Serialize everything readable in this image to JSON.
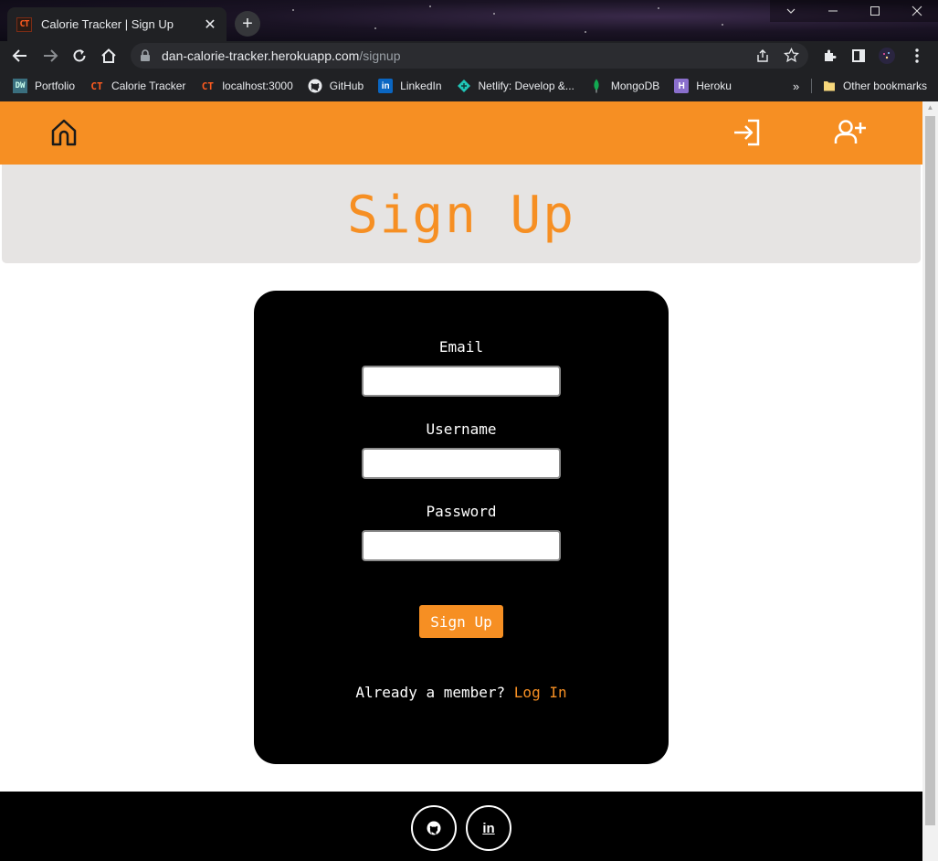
{
  "browser": {
    "tab_title": "Calorie Tracker | Sign Up",
    "tab_favicon": "CT",
    "new_tab": "+",
    "tab_close": "✕",
    "url_host": "dan-calorie-tracker.herokuapp.com",
    "url_path": "/signup",
    "bookmarks": [
      {
        "label": "Portfolio",
        "icon": "DW"
      },
      {
        "label": "Calorie Tracker",
        "icon": "CT"
      },
      {
        "label": "localhost:3000",
        "icon": "CT"
      },
      {
        "label": "GitHub",
        "icon": "github-icon"
      },
      {
        "label": "LinkedIn",
        "icon": "in"
      },
      {
        "label": "Netlify: Develop &...",
        "icon": "netlify-icon"
      },
      {
        "label": "MongoDB",
        "icon": "mongodb-icon"
      },
      {
        "label": "Heroku",
        "icon": "H"
      }
    ],
    "other_bookmarks": "Other bookmarks",
    "bookmarks_overflow": "»"
  },
  "header": {
    "home_icon": "home-icon",
    "login_icon": "login-icon",
    "signup_icon": "add-user-icon",
    "color": "#f68f23"
  },
  "page": {
    "title": "Sign Up"
  },
  "form": {
    "email_label": "Email",
    "email_value": "",
    "username_label": "Username",
    "username_value": "",
    "password_label": "Password",
    "password_value": "",
    "submit_label": "Sign Up",
    "member_text": "Already a member?",
    "login_link": "Log In"
  },
  "footer": {
    "github_icon": "github-icon",
    "linkedin_label": "in"
  }
}
